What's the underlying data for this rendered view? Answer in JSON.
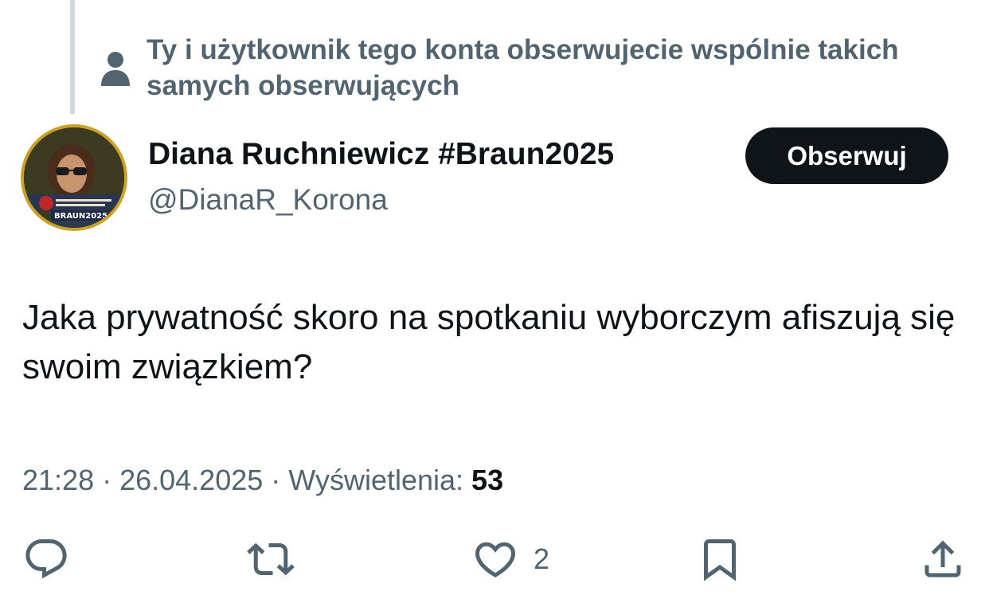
{
  "social_context": {
    "text": "Ty i użytkownik tego konta obserwujecie wspólnie takich samych obserwujących",
    "icon": "person-icon"
  },
  "author": {
    "name": "Diana Ruchniewicz #Braun2025",
    "handle": "@DianaR_Korona",
    "avatar_caption": "BRAUN2025"
  },
  "follow_button": {
    "label": "Obserwuj"
  },
  "tweet": {
    "text": "Jaka prywatność skoro na spotkaniu wyborczym afiszują się swoim związkiem?"
  },
  "meta": {
    "time": "21:28",
    "separator": " · ",
    "date": "26.04.2025",
    "views_label": "Wyświetlenia:",
    "views_count": "53"
  },
  "actions": {
    "reply": {
      "icon": "reply-icon"
    },
    "retweet": {
      "icon": "retweet-icon"
    },
    "like": {
      "icon": "heart-icon",
      "count": "2"
    },
    "bookmark": {
      "icon": "bookmark-icon"
    },
    "share": {
      "icon": "share-icon"
    }
  },
  "colors": {
    "text_primary": "#0f1419",
    "text_secondary": "#536471",
    "thread_line": "#cfd9de",
    "follow_bg": "#0f1419"
  }
}
